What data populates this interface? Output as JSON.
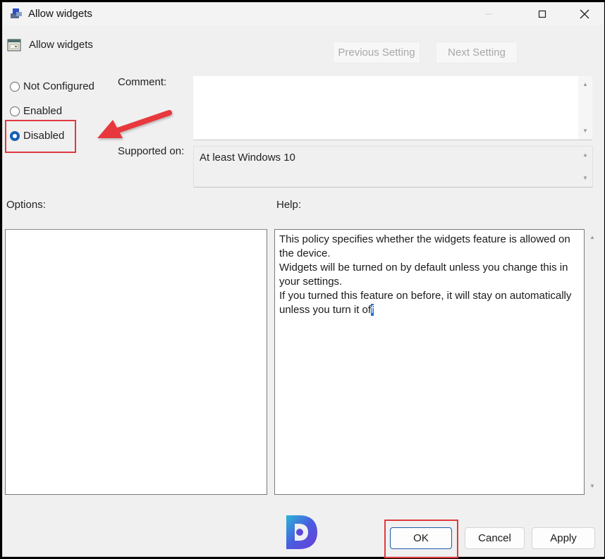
{
  "window": {
    "title": "Allow widgets",
    "controls": {
      "minimize": "—",
      "maximize": "☐",
      "close": "✕"
    }
  },
  "header": {
    "policy_name": "Allow widgets",
    "previous_setting": "Previous Setting",
    "next_setting": "Next Setting"
  },
  "state": {
    "options": [
      {
        "label": "Not Configured",
        "checked": false
      },
      {
        "label": "Enabled",
        "checked": false
      },
      {
        "label": "Disabled",
        "checked": true
      }
    ]
  },
  "labels": {
    "comment": "Comment:",
    "supported_on": "Supported on:",
    "options": "Options:",
    "help": "Help:"
  },
  "comment": {
    "value": ""
  },
  "supported_on": {
    "value": "At least Windows 10"
  },
  "help": {
    "lines": [
      "This policy specifies whether the widgets feature is allowed on the device.",
      "Widgets will be turned on by default unless you change this in your settings.",
      "If you turned this feature on before, it will stay on automatically unless you turn it of"
    ],
    "selected_char": "f"
  },
  "buttons": {
    "ok": "OK",
    "cancel": "Cancel",
    "apply": "Apply"
  },
  "annotations": {
    "highlight_color": "#e0393e",
    "arrow_color": "#e8383d",
    "accent_color": "#1a5fb4"
  },
  "icons": {
    "title_icon": "group-policy-icon",
    "policy_icon": "policy-setting-icon",
    "scroll_up": "▲",
    "scroll_down": "▼"
  }
}
